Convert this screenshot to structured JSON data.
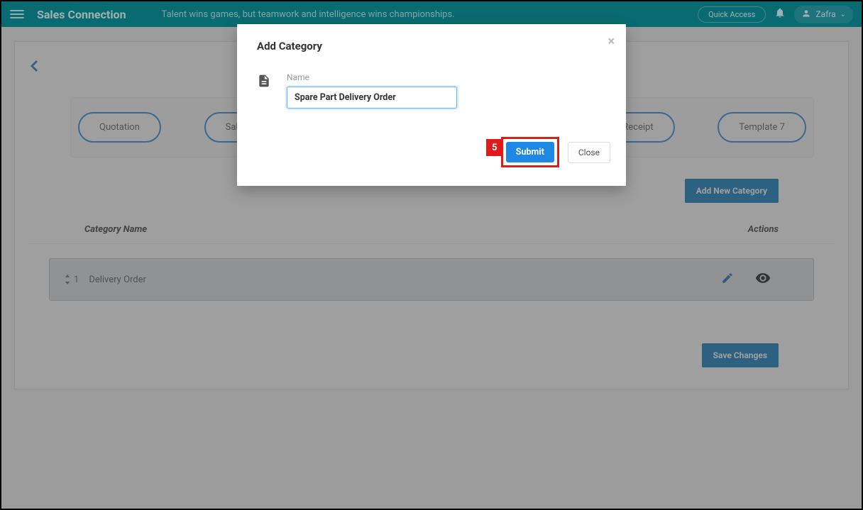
{
  "header": {
    "app_title": "Sales Connection",
    "tagline": "Talent wins games, but teamwork and intelligence wins championships.",
    "quick_access": "Quick Access",
    "user_name": "Zafra"
  },
  "main": {
    "pills": {
      "quotation": "Quotation",
      "sales_order": "Sales Orde",
      "receipt": "Receipt",
      "template7": "Template 7"
    },
    "add_new_category": "Add New Category",
    "table": {
      "header_name": "Category Name",
      "header_actions": "Actions",
      "rows": [
        {
          "index": "1",
          "name": "Delivery Order"
        }
      ]
    },
    "save_changes": "Save Changes"
  },
  "modal": {
    "title": "Add Category",
    "field_label": "Name",
    "field_value": "Spare Part Delivery Order",
    "submit": "Submit",
    "close": "Close",
    "step_number": "5"
  }
}
